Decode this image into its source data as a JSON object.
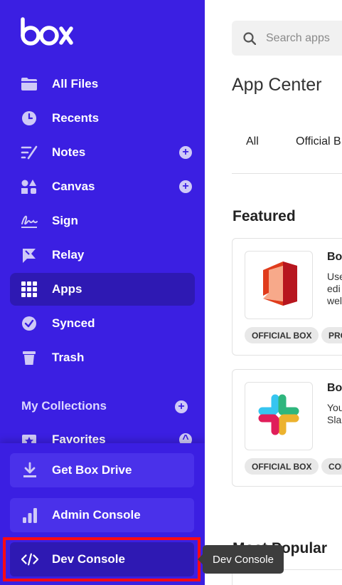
{
  "sidebar": {
    "logo_text": "box",
    "items": [
      {
        "label": "All Files",
        "icon": "folder-icon"
      },
      {
        "label": "Recents",
        "icon": "clock-icon"
      },
      {
        "label": "Notes",
        "icon": "notes-icon"
      },
      {
        "label": "Canvas",
        "icon": "canvas-icon"
      },
      {
        "label": "Sign",
        "icon": "sign-icon"
      },
      {
        "label": "Relay",
        "icon": "relay-icon"
      },
      {
        "label": "Apps",
        "icon": "apps-grid-icon"
      },
      {
        "label": "Synced",
        "icon": "check-circle-icon"
      },
      {
        "label": "Trash",
        "icon": "trash-icon"
      },
      {
        "label": "Favorites",
        "icon": "star-icon"
      }
    ],
    "collections_label": "My Collections",
    "bottom": {
      "get_drive": "Get Box Drive",
      "admin_console": "Admin Console",
      "dev_console": "Dev Console"
    }
  },
  "tooltip": "Dev Console",
  "main": {
    "search_placeholder": "Search apps",
    "title": "App Center",
    "tabs": [
      "All",
      "Official B"
    ],
    "featured_title": "Featured",
    "cards": [
      {
        "name": "Bo",
        "desc": "Use\nedi\nwel",
        "badges": [
          "OFFICIAL BOX",
          "PRO"
        ]
      },
      {
        "name": "Bo",
        "desc": "You\nSla",
        "badges": [
          "OFFICIAL BOX",
          "COL"
        ]
      }
    ],
    "most_popular_title": "Most Popular"
  },
  "colors": {
    "sidebar_bg": "#3b1fe2",
    "active_bg": "#2e19b3",
    "highlight": "#ff0a14"
  }
}
